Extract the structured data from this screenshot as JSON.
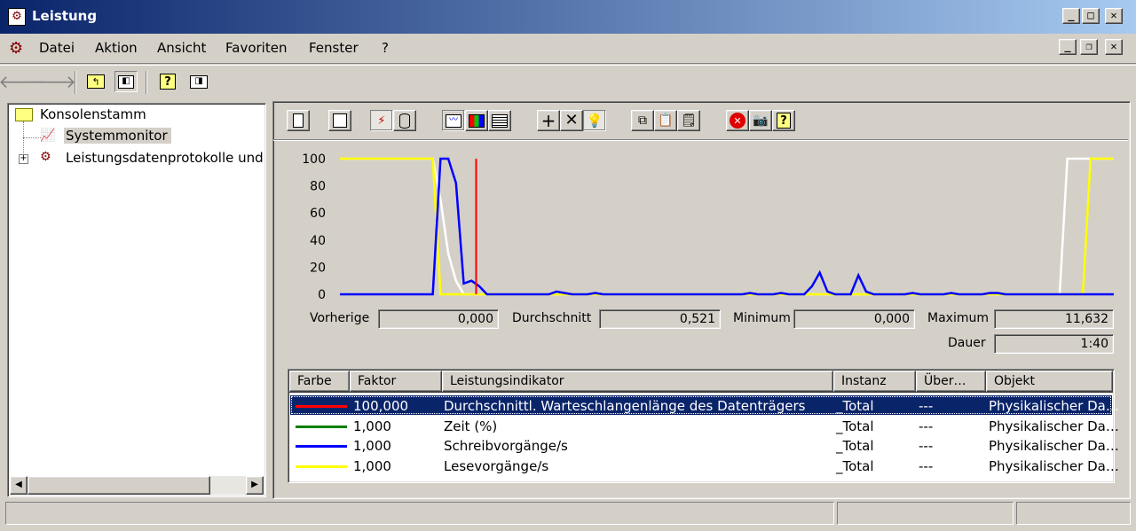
{
  "window": {
    "title": "Leistung"
  },
  "menu": [
    "Datei",
    "Aktion",
    "Ansicht",
    "Favoriten",
    "Fenster",
    "?"
  ],
  "tree": {
    "root": "Konsolenstamm",
    "items": [
      "Systemmonitor",
      "Leistungsdatenprotokolle und W"
    ]
  },
  "stats": {
    "last_label": "Vorherige",
    "last": "0,000",
    "avg_label": "Durchschnitt",
    "avg": "0,521",
    "min_label": "Minimum",
    "min": "0,000",
    "max_label": "Maximum",
    "max": "11,632",
    "dur_label": "Dauer",
    "dur": "1:40"
  },
  "chart_data": {
    "type": "line",
    "ylim": [
      0,
      100
    ],
    "yticks": [
      "100",
      "80",
      "60",
      "40",
      "20",
      "0"
    ],
    "x": [
      0,
      1,
      2,
      3,
      4,
      5,
      6,
      7,
      8,
      9,
      10,
      11,
      12,
      13,
      14,
      15,
      16,
      17,
      18,
      19,
      20,
      21,
      22,
      23,
      24,
      25,
      26,
      27,
      28,
      29,
      30,
      31,
      32,
      33,
      34,
      35,
      36,
      37,
      38,
      39,
      40,
      41,
      42,
      43,
      44,
      45,
      46,
      47,
      48,
      49,
      50,
      51,
      52,
      53,
      54,
      55,
      56,
      57,
      58,
      59,
      60,
      61,
      62,
      63,
      64,
      65,
      66,
      67,
      68,
      69,
      70,
      71,
      72,
      73,
      74,
      75,
      76,
      77,
      78,
      79,
      80,
      81,
      82,
      83,
      84,
      85,
      86,
      87,
      88,
      89,
      90,
      91,
      92,
      93,
      94,
      95,
      96,
      97,
      98,
      99,
      100
    ],
    "series": [
      {
        "color": "#ff0000",
        "kind": "marker",
        "x_at": 17.6
      },
      {
        "color": "#0000ff",
        "values": [
          0,
          0,
          0,
          0,
          0,
          0,
          0,
          0,
          0,
          0,
          0,
          0,
          0,
          100,
          100,
          82,
          8,
          10,
          6,
          0,
          0,
          0,
          0,
          0,
          0,
          0,
          0,
          0,
          2,
          1,
          0,
          0,
          0,
          1,
          0,
          0,
          0,
          0,
          0,
          0,
          0,
          0,
          0,
          0,
          0,
          0,
          0,
          0,
          0,
          0,
          0,
          0,
          0,
          1,
          0,
          0,
          0,
          1,
          0,
          0,
          0,
          6,
          16,
          2,
          0,
          0,
          0,
          14,
          2,
          0,
          0,
          0,
          0,
          0,
          1,
          0,
          0,
          0,
          0,
          1,
          0,
          0,
          0,
          0,
          1,
          1,
          0,
          0,
          0,
          0,
          0,
          0,
          0,
          0,
          0,
          0,
          0,
          0,
          0,
          0,
          0
        ]
      },
      {
        "color": "#ffffff",
        "values": [
          100,
          100,
          100,
          100,
          100,
          100,
          100,
          100,
          100,
          100,
          100,
          100,
          100,
          70,
          30,
          10,
          0,
          0,
          0,
          0,
          0,
          0,
          0,
          0,
          0,
          0,
          0,
          0,
          0,
          0,
          0,
          0,
          0,
          0,
          0,
          0,
          0,
          0,
          0,
          0,
          0,
          0,
          0,
          0,
          0,
          0,
          0,
          0,
          0,
          0,
          0,
          0,
          0,
          0,
          0,
          0,
          0,
          0,
          0,
          0,
          0,
          0,
          0,
          0,
          0,
          0,
          0,
          0,
          0,
          0,
          0,
          0,
          0,
          0,
          0,
          0,
          0,
          0,
          0,
          0,
          0,
          0,
          0,
          0,
          0,
          0,
          0,
          0,
          0,
          0,
          0,
          0,
          0,
          0,
          100,
          100,
          100,
          100,
          100,
          100,
          100
        ]
      },
      {
        "color": "#ffff00",
        "values": [
          100,
          100,
          100,
          100,
          100,
          100,
          100,
          100,
          100,
          100,
          100,
          100,
          100,
          0,
          0,
          0,
          0,
          0,
          0,
          0,
          0,
          0,
          0,
          0,
          0,
          0,
          0,
          0,
          0,
          0,
          0,
          0,
          0,
          0,
          0,
          0,
          0,
          0,
          0,
          0,
          0,
          0,
          0,
          0,
          0,
          0,
          0,
          0,
          0,
          0,
          0,
          0,
          0,
          0,
          0,
          0,
          0,
          0,
          0,
          0,
          0,
          0,
          0,
          0,
          0,
          0,
          0,
          0,
          0,
          0,
          0,
          0,
          0,
          0,
          0,
          0,
          0,
          0,
          0,
          0,
          0,
          0,
          0,
          0,
          0,
          0,
          0,
          0,
          0,
          0,
          0,
          0,
          0,
          0,
          0,
          0,
          0,
          100,
          100,
          100,
          100
        ]
      }
    ]
  },
  "table": {
    "headers": [
      "Farbe",
      "Faktor",
      "Leistungsindikator",
      "Instanz",
      "Über…",
      "Objekt"
    ],
    "rows": [
      {
        "color": "#ff0000",
        "factor": "100,000",
        "counter": "Durchschnittl. Warteschlangenlänge des Datenträgers",
        "instance": "_Total",
        "parent": "---",
        "object": "Physikalischer Da…",
        "selected": true
      },
      {
        "color": "#008000",
        "factor": "1,000",
        "counter": "Zeit (%)",
        "instance": "_Total",
        "parent": "---",
        "object": "Physikalischer Da…"
      },
      {
        "color": "#0000ff",
        "factor": "1,000",
        "counter": "Schreibvorgänge/s",
        "instance": "_Total",
        "parent": "---",
        "object": "Physikalischer Da…"
      },
      {
        "color": "#ffff00",
        "factor": "1,000",
        "counter": "Lesevorgänge/s",
        "instance": "_Total",
        "parent": "---",
        "object": "Physikalischer Da…"
      }
    ]
  }
}
